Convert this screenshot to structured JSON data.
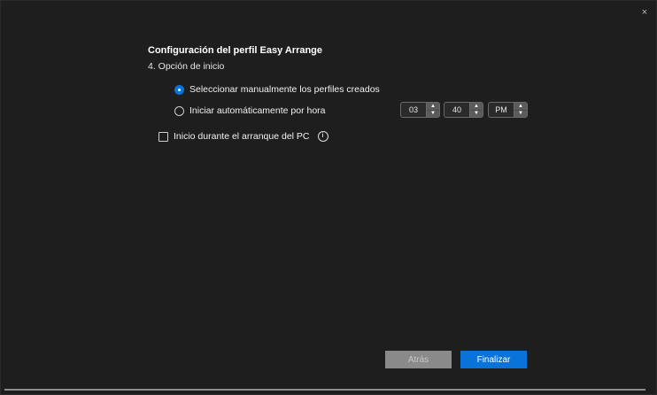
{
  "window": {
    "close_glyph": "×"
  },
  "header": {
    "title": "Configuración del perfil Easy Arrange",
    "step": "4. Opción de inicio"
  },
  "options": {
    "manual_label": "Seleccionar manualmente los perfiles creados",
    "manual_selected": true,
    "auto_label": "Iniciar automáticamente por hora",
    "auto_selected": false
  },
  "time": {
    "hour": "03",
    "minute": "40",
    "period": "PM"
  },
  "startup": {
    "label": "Inicio durante el arranque del PC",
    "checked": false,
    "info_glyph": "i"
  },
  "footer": {
    "back_label": "Atrás",
    "finish_label": "Finalizar"
  },
  "colors": {
    "accent": "#0a73d9",
    "background": "#1e1e1e",
    "disabled_button": "#8a8a8a"
  }
}
